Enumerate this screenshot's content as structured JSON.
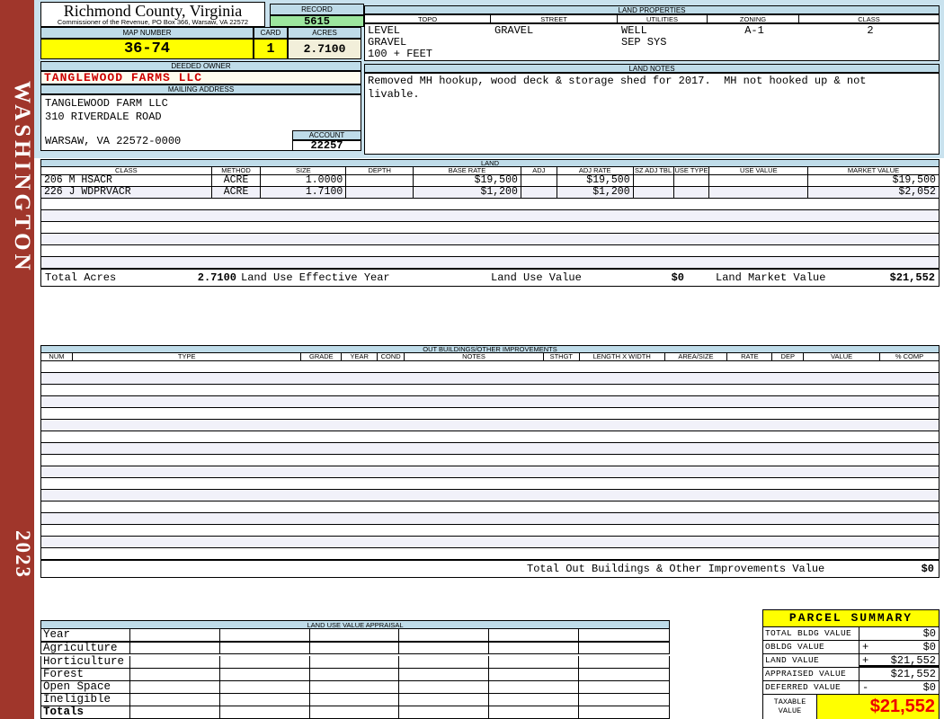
{
  "colors": {
    "sidebar_red": "#A0362B",
    "band_blue": "#C9E2EE",
    "strip_blue": "#BFDCE9",
    "record_green": "#9CE69E",
    "hl_yellow": "#FFFF00",
    "cream": "#F2EFDA",
    "stripe": "#F1F1F9",
    "owner_red": "#CC0000",
    "taxable_red": "#EE0000"
  },
  "sidebar": {
    "state": "WASHINGTON",
    "year": "2023"
  },
  "header": {
    "county": "Richmond County, Virginia",
    "subtitle": "Commissioner of the Revenue, PO Box 366, Warsaw, VA 22572",
    "record_label": "RECORD",
    "record_value": "5615",
    "map_number_label": "MAP NUMBER",
    "map_number": "36-74",
    "card_label": "CARD",
    "card": "1",
    "acres_label": "ACRES",
    "acres": "2.7100"
  },
  "owner": {
    "deeded_owner_label": "DEEDED OWNER",
    "deeded_owner": "TANGLEWOOD FARMS LLC",
    "mailing_address_label": "MAILING ADDRESS",
    "address_lines": [
      "TANGLEWOOD FARM LLC",
      "310 RIVERDALE ROAD",
      "",
      "WARSAW, VA 22572-0000"
    ],
    "account_label": "ACCOUNT",
    "account": "22257"
  },
  "land_properties": {
    "title": "LAND PROPERTIES",
    "columns": [
      "TOPO",
      "STREET",
      "UTILITIES",
      "ZONING",
      "CLASS"
    ],
    "topo": [
      "LEVEL",
      "GRAVEL",
      "100 + FEET"
    ],
    "street": [
      "GRAVEL"
    ],
    "utilities": [
      "WELL",
      "SEP SYS"
    ],
    "zoning": "A-1",
    "class": "2"
  },
  "land_notes": {
    "title": "LAND NOTES",
    "text": "Removed MH hookup, wood deck & storage shed for 2017.  MH not hooked up & not\nlivable."
  },
  "land": {
    "title": "LAND",
    "columns": [
      "CLASS",
      "METHOD",
      "SIZE",
      "DEPTH",
      "BASE RATE",
      "ADJ",
      "ADJ RATE",
      "SZ ADJ TBL",
      "USE TYPE",
      "USE VALUE",
      "MARKET VALUE"
    ],
    "rows": [
      [
        "206 M HSACR",
        "ACRE",
        "1.0000",
        "",
        "$19,500",
        "",
        "$19,500",
        "",
        "",
        "",
        "$19,500"
      ],
      [
        "226 J WDPRVACR",
        "ACRE",
        "1.7100",
        "",
        "$1,200",
        "",
        "$1,200",
        "",
        "",
        "",
        "$2,052"
      ]
    ],
    "empty_rows": 6,
    "totals": {
      "total_acres_label": "Total Acres",
      "total_acres": "2.7100",
      "effective_year_label": "Land Use Effective Year",
      "effective_year": "",
      "use_value_label": "Land Use Value",
      "use_value": "$0",
      "market_value_label": "Land Market Value",
      "market_value": "$21,552"
    }
  },
  "out_buildings": {
    "title": "OUT BUILDINGS/OTHER IMPROVEMENTS",
    "columns": [
      "NUM",
      "TYPE",
      "GRADE",
      "YEAR",
      "COND",
      "NOTES",
      "STHGT",
      "LENGTH X WIDTH",
      "AREA/SIZE",
      "RATE",
      "DEP",
      "VALUE",
      "% COMP"
    ],
    "empty_rows": 17,
    "total_label": "Total Out Buildings & Other Improvements Value",
    "total_value": "$0"
  },
  "land_use_appraisal": {
    "title": "LAND USE VALUE APPRAISAL",
    "row_labels": [
      "Year",
      "Agriculture",
      "Horticulture",
      "Forest",
      "Open Space",
      "Ineligible",
      "Totals"
    ],
    "data_columns": 6
  },
  "parcel_summary": {
    "title": "PARCEL SUMMARY",
    "rows": [
      {
        "label": "TOTAL BLDG VALUE",
        "op": "",
        "value": "$0"
      },
      {
        "label": "OBLDG VALUE",
        "op": "+",
        "value": "$0"
      },
      {
        "label": "LAND VALUE",
        "op": "+",
        "value": "$21,552"
      },
      {
        "label": "APPRAISED VALUE",
        "op": "",
        "value": "$21,552"
      },
      {
        "label": "DEFERRED VALUE",
        "op": "-",
        "value": "$0"
      }
    ],
    "taxable_label": "TAXABLE VALUE",
    "taxable_value": "$21,552"
  }
}
